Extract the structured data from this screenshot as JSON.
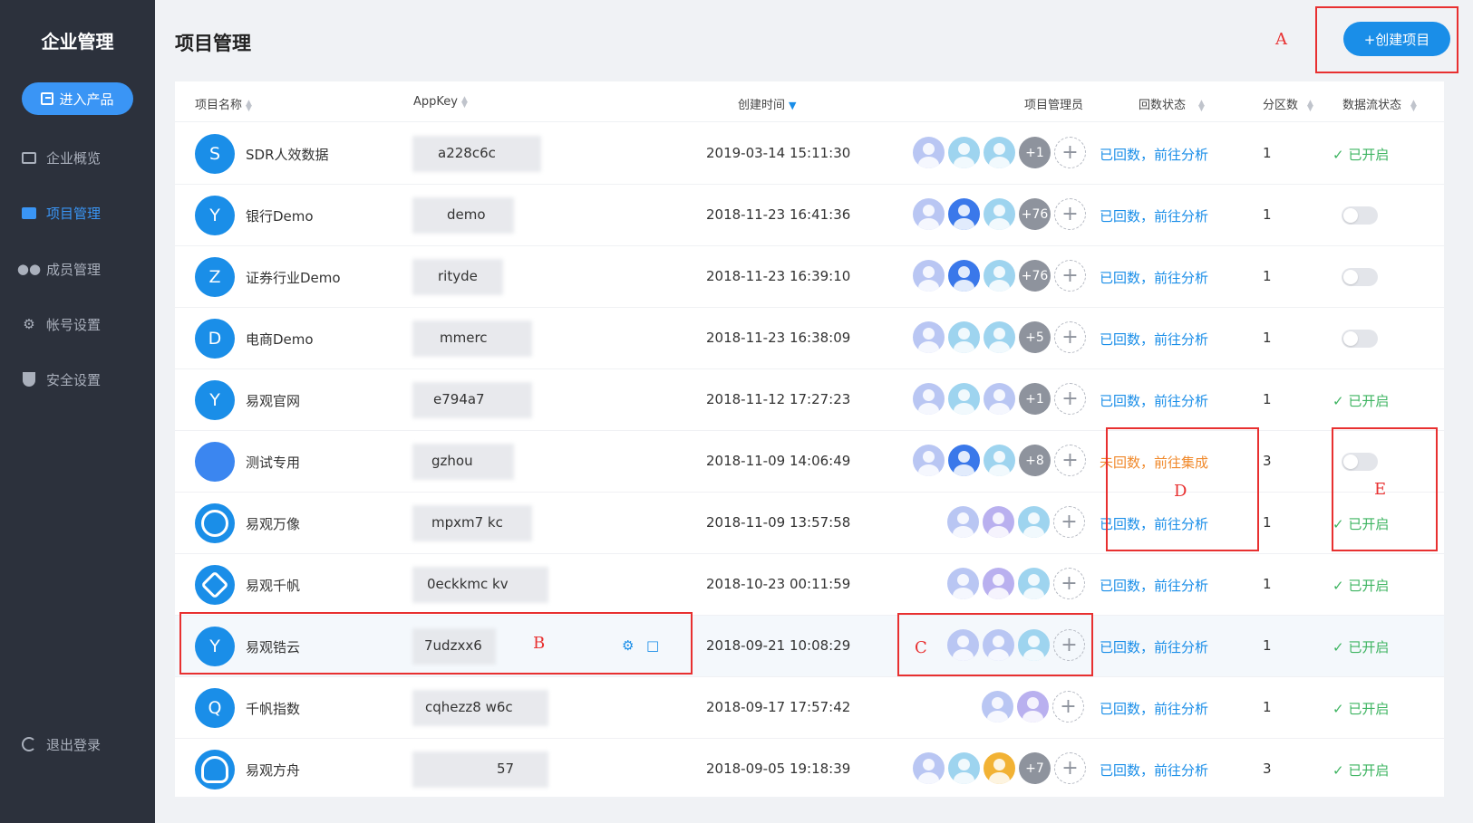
{
  "sidebar": {
    "brand": "企业管理",
    "enter_button": "进入产品",
    "items": [
      {
        "label": "企业概览",
        "icon": "monitor-icon"
      },
      {
        "label": "项目管理",
        "icon": "folder-icon"
      },
      {
        "label": "成员管理",
        "icon": "users-icon"
      },
      {
        "label": "帐号设置",
        "icon": "gear-icon"
      },
      {
        "label": "安全设置",
        "icon": "shield-icon"
      }
    ],
    "logout": "退出登录"
  },
  "header": {
    "title": "项目管理",
    "create_button": "+创建项目"
  },
  "table": {
    "columns": [
      "项目名称",
      "AppKey",
      "创建时间",
      "项目管理员",
      "回数状态",
      "分区数",
      "数据流状态"
    ],
    "rows": [
      {
        "initial": "S",
        "name": "SDR人效数据",
        "appkey": "a228c6c",
        "time": "2019-03-14 15:11:30",
        "more": "+1",
        "status": "已回数，前往分析",
        "parts": "1",
        "flow": "✓ 已开启"
      },
      {
        "initial": "Y",
        "name": "银行Demo",
        "appkey": "demo",
        "time": "2018-11-23 16:41:36",
        "more": "+76",
        "status": "已回数，前往分析",
        "parts": "1",
        "flow": ""
      },
      {
        "initial": "Z",
        "name": "证券行业Demo",
        "appkey": "ritydе",
        "time": "2018-11-23 16:39:10",
        "more": "+76",
        "status": "已回数，前往分析",
        "parts": "1",
        "flow": ""
      },
      {
        "initial": "D",
        "name": "电商Demo",
        "appkey": "mmerc",
        "time": "2018-11-23 16:38:09",
        "more": "+5",
        "status": "已回数，前往分析",
        "parts": "1",
        "flow": ""
      },
      {
        "initial": "Y",
        "name": "易观官网",
        "appkey": "e794a7",
        "time": "2018-11-12 17:27:23",
        "more": "+1",
        "status": "已回数，前往分析",
        "parts": "1",
        "flow": "✓ 已开启"
      },
      {
        "initial": "",
        "name": "测试专用",
        "appkey": "gzhou",
        "time": "2018-11-09 14:06:49",
        "more": "+8",
        "status": "未回数，前往集成",
        "parts": "3",
        "flow": ""
      },
      {
        "initial": "",
        "name": "易观万像",
        "appkey": "mpxm7 kc",
        "time": "2018-11-09 13:57:58",
        "more": "",
        "status": "已回数，前往分析",
        "parts": "1",
        "flow": "✓ 已开启"
      },
      {
        "initial": "",
        "name": "易观千帆",
        "appkey": "0eckkmc kv",
        "time": "2018-10-23 00:11:59",
        "more": "",
        "status": "已回数，前往分析",
        "parts": "1",
        "flow": "✓ 已开启"
      },
      {
        "initial": "Y",
        "name": "易观锆云",
        "appkey": "7udzxx6",
        "time": "2018-09-21 10:08:29",
        "more": "",
        "status": "已回数，前往分析",
        "parts": "1",
        "flow": "✓ 已开启"
      },
      {
        "initial": "Q",
        "name": "千帆指数",
        "appkey": "cqhezz8 w6c",
        "time": "2018-09-17 17:57:42",
        "more": "",
        "status": "已回数，前往分析",
        "parts": "1",
        "flow": "✓ 已开启"
      },
      {
        "initial": "",
        "name": "易观方舟",
        "appkey": "57",
        "time": "2018-09-05 19:18:39",
        "more": "+7",
        "status": "已回数，前往分析",
        "parts": "3",
        "flow": "✓ 已开启"
      }
    ]
  },
  "annotations": [
    "A",
    "B",
    "C",
    "D",
    "E"
  ],
  "colors": {
    "sidebar": "#2c313c",
    "accent": "#1a8ee8",
    "warn": "#f0892b",
    "ok": "#3eb461",
    "annotation": "#e83030"
  }
}
